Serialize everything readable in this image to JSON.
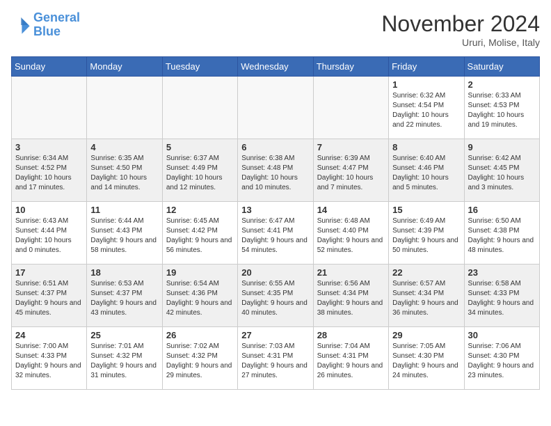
{
  "logo": {
    "line1": "General",
    "line2": "Blue"
  },
  "title": "November 2024",
  "location": "Ururi, Molise, Italy",
  "weekdays": [
    "Sunday",
    "Monday",
    "Tuesday",
    "Wednesday",
    "Thursday",
    "Friday",
    "Saturday"
  ],
  "weeks": [
    [
      {
        "day": "",
        "info": ""
      },
      {
        "day": "",
        "info": ""
      },
      {
        "day": "",
        "info": ""
      },
      {
        "day": "",
        "info": ""
      },
      {
        "day": "",
        "info": ""
      },
      {
        "day": "1",
        "info": "Sunrise: 6:32 AM\nSunset: 4:54 PM\nDaylight: 10 hours and 22 minutes."
      },
      {
        "day": "2",
        "info": "Sunrise: 6:33 AM\nSunset: 4:53 PM\nDaylight: 10 hours and 19 minutes."
      }
    ],
    [
      {
        "day": "3",
        "info": "Sunrise: 6:34 AM\nSunset: 4:52 PM\nDaylight: 10 hours and 17 minutes."
      },
      {
        "day": "4",
        "info": "Sunrise: 6:35 AM\nSunset: 4:50 PM\nDaylight: 10 hours and 14 minutes."
      },
      {
        "day": "5",
        "info": "Sunrise: 6:37 AM\nSunset: 4:49 PM\nDaylight: 10 hours and 12 minutes."
      },
      {
        "day": "6",
        "info": "Sunrise: 6:38 AM\nSunset: 4:48 PM\nDaylight: 10 hours and 10 minutes."
      },
      {
        "day": "7",
        "info": "Sunrise: 6:39 AM\nSunset: 4:47 PM\nDaylight: 10 hours and 7 minutes."
      },
      {
        "day": "8",
        "info": "Sunrise: 6:40 AM\nSunset: 4:46 PM\nDaylight: 10 hours and 5 minutes."
      },
      {
        "day": "9",
        "info": "Sunrise: 6:42 AM\nSunset: 4:45 PM\nDaylight: 10 hours and 3 minutes."
      }
    ],
    [
      {
        "day": "10",
        "info": "Sunrise: 6:43 AM\nSunset: 4:44 PM\nDaylight: 10 hours and 0 minutes."
      },
      {
        "day": "11",
        "info": "Sunrise: 6:44 AM\nSunset: 4:43 PM\nDaylight: 9 hours and 58 minutes."
      },
      {
        "day": "12",
        "info": "Sunrise: 6:45 AM\nSunset: 4:42 PM\nDaylight: 9 hours and 56 minutes."
      },
      {
        "day": "13",
        "info": "Sunrise: 6:47 AM\nSunset: 4:41 PM\nDaylight: 9 hours and 54 minutes."
      },
      {
        "day": "14",
        "info": "Sunrise: 6:48 AM\nSunset: 4:40 PM\nDaylight: 9 hours and 52 minutes."
      },
      {
        "day": "15",
        "info": "Sunrise: 6:49 AM\nSunset: 4:39 PM\nDaylight: 9 hours and 50 minutes."
      },
      {
        "day": "16",
        "info": "Sunrise: 6:50 AM\nSunset: 4:38 PM\nDaylight: 9 hours and 48 minutes."
      }
    ],
    [
      {
        "day": "17",
        "info": "Sunrise: 6:51 AM\nSunset: 4:37 PM\nDaylight: 9 hours and 45 minutes."
      },
      {
        "day": "18",
        "info": "Sunrise: 6:53 AM\nSunset: 4:37 PM\nDaylight: 9 hours and 43 minutes."
      },
      {
        "day": "19",
        "info": "Sunrise: 6:54 AM\nSunset: 4:36 PM\nDaylight: 9 hours and 42 minutes."
      },
      {
        "day": "20",
        "info": "Sunrise: 6:55 AM\nSunset: 4:35 PM\nDaylight: 9 hours and 40 minutes."
      },
      {
        "day": "21",
        "info": "Sunrise: 6:56 AM\nSunset: 4:34 PM\nDaylight: 9 hours and 38 minutes."
      },
      {
        "day": "22",
        "info": "Sunrise: 6:57 AM\nSunset: 4:34 PM\nDaylight: 9 hours and 36 minutes."
      },
      {
        "day": "23",
        "info": "Sunrise: 6:58 AM\nSunset: 4:33 PM\nDaylight: 9 hours and 34 minutes."
      }
    ],
    [
      {
        "day": "24",
        "info": "Sunrise: 7:00 AM\nSunset: 4:33 PM\nDaylight: 9 hours and 32 minutes."
      },
      {
        "day": "25",
        "info": "Sunrise: 7:01 AM\nSunset: 4:32 PM\nDaylight: 9 hours and 31 minutes."
      },
      {
        "day": "26",
        "info": "Sunrise: 7:02 AM\nSunset: 4:32 PM\nDaylight: 9 hours and 29 minutes."
      },
      {
        "day": "27",
        "info": "Sunrise: 7:03 AM\nSunset: 4:31 PM\nDaylight: 9 hours and 27 minutes."
      },
      {
        "day": "28",
        "info": "Sunrise: 7:04 AM\nSunset: 4:31 PM\nDaylight: 9 hours and 26 minutes."
      },
      {
        "day": "29",
        "info": "Sunrise: 7:05 AM\nSunset: 4:30 PM\nDaylight: 9 hours and 24 minutes."
      },
      {
        "day": "30",
        "info": "Sunrise: 7:06 AM\nSunset: 4:30 PM\nDaylight: 9 hours and 23 minutes."
      }
    ]
  ]
}
